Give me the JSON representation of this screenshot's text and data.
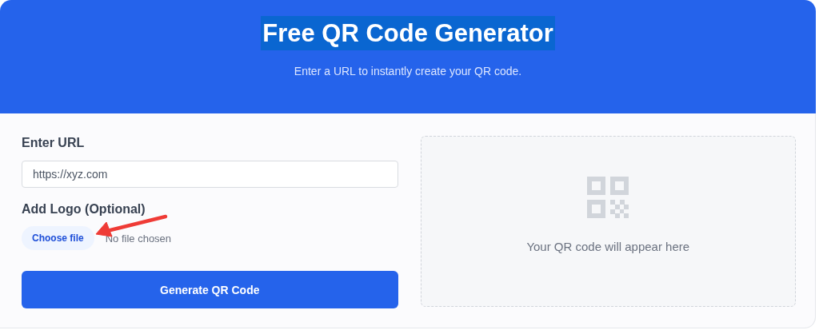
{
  "header": {
    "title": {
      "text": "Free QR Code Generator",
      "selected": true
    },
    "subtitle": "Enter a URL to instantly create your QR code."
  },
  "form": {
    "url_label": "Enter URL",
    "url_field": {
      "placeholder": "https://xyz.com"
    },
    "logo_label": "Add Logo (Optional)",
    "file_button": "Choose file",
    "file_status": "No file chosen",
    "submit": "Generate QR Code"
  },
  "preview": {
    "message": "Your QR code will appear here"
  }
}
